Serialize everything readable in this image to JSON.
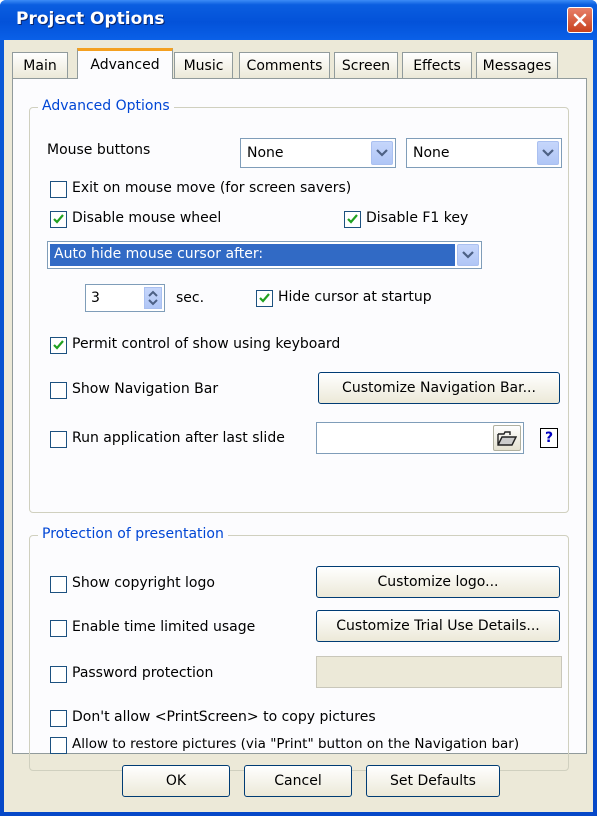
{
  "window": {
    "title": "Project Options"
  },
  "tabs": [
    "Main",
    "Advanced",
    "Music",
    "Comments",
    "Screen",
    "Effects",
    "Messages"
  ],
  "advanced": {
    "group_title": "Advanced Options",
    "mouse_buttons_label": "Mouse buttons",
    "mouse_button_1": "None",
    "mouse_button_2": "None",
    "exit_on_mouse_move": {
      "label": "Exit on mouse move (for screen savers)",
      "checked": false
    },
    "disable_mouse_wheel": {
      "label": "Disable mouse wheel",
      "checked": true
    },
    "disable_f1_key": {
      "label": "Disable F1 key",
      "checked": true
    },
    "cursor_mode": "Auto hide mouse cursor after:",
    "hide_seconds": "3",
    "seconds_unit": "sec.",
    "hide_cursor_startup": {
      "label": "Hide cursor at startup",
      "checked": true
    },
    "permit_keyboard": {
      "label": "Permit control of show using keyboard",
      "checked": true
    },
    "show_nav_bar": {
      "label": "Show Navigation Bar",
      "checked": false
    },
    "customize_nav_bar_button": "Customize Navigation Bar...",
    "run_after_last_slide": {
      "label": "Run application after last slide",
      "checked": false
    },
    "run_app_path": "",
    "help_glyph": "?"
  },
  "protection": {
    "group_title": "Protection of presentation",
    "show_copyright_logo": {
      "label": "Show copyright logo",
      "checked": false
    },
    "customize_logo_button": "Customize logo...",
    "time_limited": {
      "label": "Enable time limited usage",
      "checked": false
    },
    "customize_trial_button": "Customize Trial Use Details...",
    "password_protection": {
      "label": "Password protection",
      "checked": false
    },
    "password_value": "",
    "no_printscreen": {
      "label": "Don't allow <PrintScreen> to copy pictures",
      "checked": false
    },
    "allow_restore": {
      "label": "Allow to restore pictures (via \"Print\" button on the Navigation bar)",
      "checked": false
    }
  },
  "footer": {
    "ok": "OK",
    "cancel": "Cancel",
    "set_defaults": "Set Defaults"
  }
}
